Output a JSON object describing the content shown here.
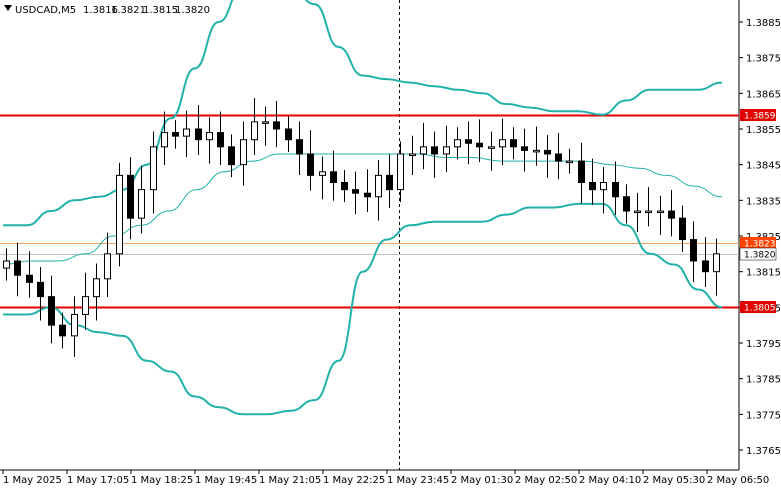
{
  "header": {
    "symbol": "USDCAD,M5",
    "open": "1.3816",
    "high": "1.3821",
    "low": "1.3815",
    "close": "1.3820"
  },
  "colors": {
    "candle": "#000000",
    "bollinger": "#20b2aa",
    "resistance_line": "#e00000",
    "current_price_line": "#c0c0c0",
    "previous_level_line": "#f0a060",
    "label_red_bg": "#e00000",
    "label_orange_bg": "#ff4500"
  },
  "chart_data": {
    "type": "candlestick",
    "symbol": "USDCAD",
    "timeframe": "M5",
    "ylim": [
      1.376,
      1.3895
    ],
    "y_ticks": [
      "1.3885",
      "1.3875",
      "1.3865",
      "1.3855",
      "1.3845",
      "1.3835",
      "1.3825",
      "1.3815",
      "1.3805",
      "1.3795",
      "1.3785",
      "1.3775",
      "1.3765"
    ],
    "x_ticks": [
      "1 May 2025",
      "1 May 17:05",
      "1 May 18:25",
      "1 May 19:45",
      "1 May 21:05",
      "1 May 22:25",
      "1 May 23:45",
      "2 May 01:30",
      "2 May 02:50",
      "2 May 04:10",
      "2 May 05:30",
      "2 May 06:50"
    ],
    "horizontal_lines": [
      {
        "price": 1.3859,
        "label": "1.3859",
        "role": "resistance"
      },
      {
        "price": 1.3805,
        "label": "1.3805",
        "role": "support"
      },
      {
        "price": 1.3823,
        "label": "1.3823",
        "role": "level"
      },
      {
        "price": 1.382,
        "label": "1.3820",
        "role": "current"
      }
    ],
    "close_path": [
      1.3818,
      1.3814,
      1.3812,
      1.3808,
      1.38,
      1.3797,
      1.3803,
      1.3808,
      1.3813,
      1.382,
      1.3842,
      1.383,
      1.3838,
      1.385,
      1.3854,
      1.3853,
      1.3855,
      1.3852,
      1.3854,
      1.385,
      1.3845,
      1.3852,
      1.3857,
      1.3857,
      1.3855,
      1.3852,
      1.3848,
      1.3842,
      1.3843,
      1.384,
      1.3838,
      1.3837,
      1.3836,
      1.3842,
      1.3838,
      1.3848,
      1.3848,
      1.385,
      1.3848,
      1.385,
      1.3852,
      1.3851,
      1.385,
      1.385,
      1.3852,
      1.385,
      1.3849,
      1.3849,
      1.3848,
      1.3846,
      1.3846,
      1.384,
      1.3838,
      1.384,
      1.3836,
      1.3832,
      1.3832,
      1.3832,
      1.3832,
      1.383,
      1.3824,
      1.3818,
      1.3815,
      1.382
    ],
    "bollinger_upper": [
      1.3828,
      1.3828,
      1.3832,
      1.3835,
      1.3836,
      1.3838,
      1.3845,
      1.3858,
      1.3872,
      1.3885,
      1.3895,
      1.3895,
      1.3895,
      1.389,
      1.3878,
      1.387,
      1.3869,
      1.3868,
      1.3867,
      1.3866,
      1.3865,
      1.3862,
      1.3861,
      1.386,
      1.386,
      1.3859,
      1.3863,
      1.3866,
      1.3866,
      1.3866,
      1.3868
    ],
    "bollinger_middle": [
      1.3817,
      1.3818,
      1.3818,
      1.382,
      1.3825,
      1.3828,
      1.3832,
      1.3838,
      1.3843,
      1.3846,
      1.3848,
      1.3848,
      1.3848,
      1.3848,
      1.3848,
      1.3848,
      1.3847,
      1.3847,
      1.3846,
      1.3846,
      1.3846,
      1.3846,
      1.3845,
      1.3844,
      1.3842,
      1.3839,
      1.3836
    ],
    "bollinger_lower": [
      1.3803,
      1.3803,
      1.3805,
      1.38,
      1.3798,
      1.3797,
      1.379,
      1.3787,
      1.378,
      1.3777,
      1.3775,
      1.3775,
      1.3776,
      1.3779,
      1.379,
      1.3815,
      1.3824,
      1.3828,
      1.3829,
      1.3829,
      1.3829,
      1.3831,
      1.3833,
      1.3833,
      1.3834,
      1.3834,
      1.3828,
      1.382,
      1.3817,
      1.381,
      1.3805
    ]
  }
}
